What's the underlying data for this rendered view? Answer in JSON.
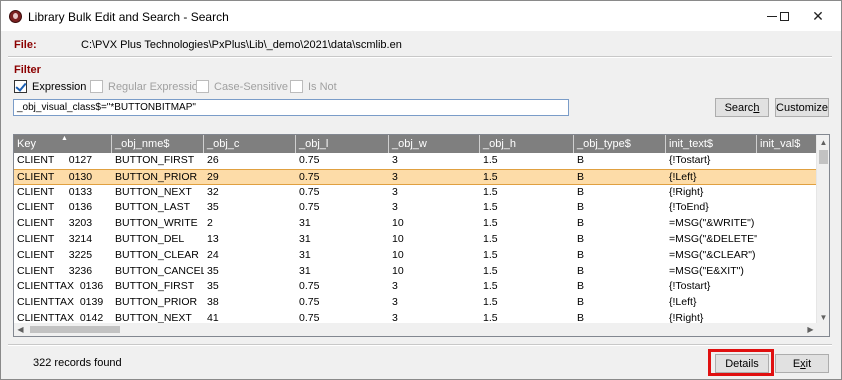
{
  "window": {
    "title": "Library Bulk Edit and Search - Search",
    "controls": {
      "minimize": "min-glyph",
      "maximize": "max-glyph",
      "close": "✕"
    }
  },
  "file": {
    "label": "File:",
    "path": "C:\\PVX Plus Technologies\\PxPlus\\Lib\\_demo\\2021\\data\\scmlib.en"
  },
  "filter": {
    "label": "Filter",
    "options": [
      {
        "label": "Expression",
        "checked": true,
        "enabled": true
      },
      {
        "label": "Regular Expression",
        "checked": false,
        "enabled": false
      },
      {
        "label": "Case-Sensitive",
        "checked": false,
        "enabled": false
      },
      {
        "label": "Is Not",
        "checked": false,
        "enabled": false
      }
    ],
    "expression_value": "_obj_visual_class$=\"*BUTTONBITMAP\"",
    "search_prefix": "Searc",
    "search_accel": "h",
    "customize_label": "Customize"
  },
  "grid": {
    "columns": [
      "Key",
      "_obj_nme$",
      "_obj_c",
      "_obj_l",
      "_obj_w",
      "_obj_h",
      "_obj_type$",
      "init_text$",
      "init_val$"
    ],
    "sorted_column_indicator": "▲",
    "selected_row_index": 1,
    "rows": [
      [
        "CLIENT     0127",
        "BUTTON_FIRST",
        "26",
        "0.75",
        "3",
        "1.5",
        "B",
        "{!Tostart}",
        ""
      ],
      [
        "CLIENT     0130",
        "BUTTON_PRIOR",
        "29",
        "0.75",
        "3",
        "1.5",
        "B",
        "{!Left}",
        ""
      ],
      [
        "CLIENT     0133",
        "BUTTON_NEXT",
        "32",
        "0.75",
        "3",
        "1.5",
        "B",
        "{!Right}",
        ""
      ],
      [
        "CLIENT     0136",
        "BUTTON_LAST",
        "35",
        "0.75",
        "3",
        "1.5",
        "B",
        "{!ToEnd}",
        ""
      ],
      [
        "CLIENT     3203",
        "BUTTON_WRITE",
        "2",
        "31",
        "10",
        "1.5",
        "B",
        "=MSG(\"&WRITE\")",
        ""
      ],
      [
        "CLIENT     3214",
        "BUTTON_DEL",
        "13",
        "31",
        "10",
        "1.5",
        "B",
        "=MSG(\"&DELETE\")",
        ""
      ],
      [
        "CLIENT     3225",
        "BUTTON_CLEAR",
        "24",
        "31",
        "10",
        "1.5",
        "B",
        "=MSG(\"&CLEAR\")",
        ""
      ],
      [
        "CLIENT     3236",
        "BUTTON_CANCEL",
        "35",
        "31",
        "10",
        "1.5",
        "B",
        "=MSG(\"E&XIT\")",
        ""
      ],
      [
        "CLIENTTAX  0136",
        "BUTTON_FIRST",
        "35",
        "0.75",
        "3",
        "1.5",
        "B",
        "{!Tostart}",
        ""
      ],
      [
        "CLIENTTAX  0139",
        "BUTTON_PRIOR",
        "38",
        "0.75",
        "3",
        "1.5",
        "B",
        "{!Left}",
        ""
      ],
      [
        "CLIENTTAX  0142",
        "BUTTON_NEXT",
        "41",
        "0.75",
        "3",
        "1.5",
        "B",
        "{!Right}",
        ""
      ]
    ]
  },
  "status": {
    "records_found": "322 records found"
  },
  "footer": {
    "details_label": "Details",
    "exit_prefix": "E",
    "exit_accel": "x",
    "exit_suffix": "it"
  },
  "colors": {
    "section_label": "#8b0000",
    "grid_header": "#7f7f7f",
    "selected_row": "#fddca8",
    "annotation_box": "#e01010"
  }
}
